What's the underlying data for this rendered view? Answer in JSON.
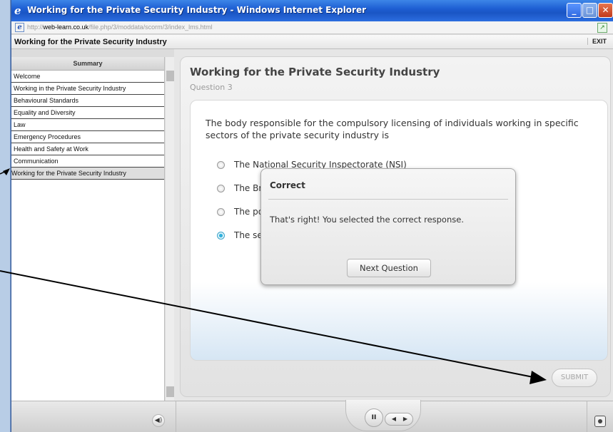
{
  "window": {
    "title": "Working for the Private Security Industry - Windows Internet Explorer",
    "address_prefix": "http://",
    "address_host": "web-learn.co.uk",
    "address_path": "/file.php/3/moddata/scorm/3/index_lms.html"
  },
  "header": {
    "course_title": "Working for the Private Security Industry",
    "exit_label": "EXIT"
  },
  "sidebar": {
    "heading": "Summary",
    "items": [
      {
        "label": "Welcome"
      },
      {
        "label": "Working in the Private Security Industry"
      },
      {
        "label": "Behavioural Standards"
      },
      {
        "label": "Equality and Diversity"
      },
      {
        "label": "Law"
      },
      {
        "label": "Emergency Procedures"
      },
      {
        "label": "Health and Safety at Work"
      },
      {
        "label": "Communication"
      },
      {
        "label": "Working for the Private Security Industry",
        "active": true
      }
    ]
  },
  "main": {
    "lesson_title": "Working for the Private Security Industry",
    "question_number": "Question 3",
    "question_text": "The body responsible for the compulsory licensing of individuals working in specific sectors of the private security industry is",
    "options": [
      {
        "label": "The National Security Inspectorate (NSI)",
        "selected": false
      },
      {
        "label": "The British",
        "selected": false
      },
      {
        "label": "The police",
        "selected": false
      },
      {
        "label": "The security",
        "selected": true
      }
    ],
    "submit_label": "SUBMIT"
  },
  "dialog": {
    "title": "Correct",
    "message": "That's right!  You selected the correct response.",
    "button_label": "Next Question"
  },
  "player": {
    "pause_glyph": "II",
    "seek_back_glyph": "◀",
    "seek_fwd_glyph": "▶",
    "volume_glyph": "◀)"
  },
  "colors": {
    "titlebar": "#1e5fd3",
    "selected_radio": "#2fb0dc"
  }
}
